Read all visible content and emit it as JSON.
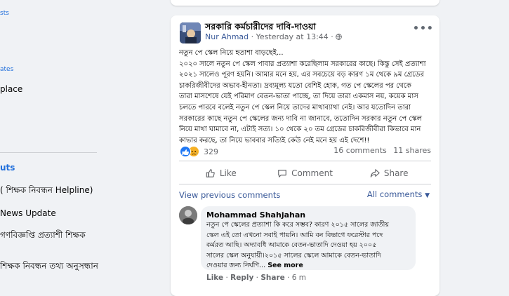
{
  "sidebar": {
    "top_link": "sts",
    "mid_link": "ates",
    "place_fragment": "place",
    "heading": "uts",
    "items": [
      "( শিক্ষক নিবন্ধন Helpline)",
      "News Update",
      "গণবিজ্ঞপ্তি প্রত্যাশী শিক্ষক",
      "শিক্ষক নিবন্ধন তথ্য অনুসন্ধান"
    ]
  },
  "post": {
    "group_name": "সরকারি কর্মচারীদের দাবি-দাওয়া",
    "author": "Nur Ahmad",
    "separator": " · ",
    "time": "Yesterday at 13:44",
    "dot": " · ",
    "more_icon": "more-horizontal-icon",
    "body_lines": [
      "নতুন পে স্কেল নিয়ে হতাশা বাড়ছেই...",
      "২০২০ সালে নতুন পে স্কেল পাবার প্রত্যাশা করেছিলাম সরকারের কাছে। কিন্তু সেই প্রত্যাশা",
      "২০২১ সালেও পূরণ হয়নি। আমার মনে হয়, এর সবচেয়ে বড় কারণ ১ম থেকে ৯ম গ্রেডের",
      "চাকরিজীবীদের অভাব-হীনতা। দ্রব্যমূল্য যতো বেশিই হোক, গত পে স্কেলের পর থেকে",
      "তারা মাসশেষে যেই পরিমাণ বেতন-ভাতা পাচ্ছে, তা দিয়ে তারা একমাস নয়, কয়েক মাস",
      "চলতে পারবে বলেই নতুন পে স্কেল নিয়ে তাদের মাথাব্যাথা নেই। আর যতোদিন তারা",
      "সরকারের কাছে নতুন পে স্কেলের জন্য দাবি না জানাবে, ততোদিন সরকার নতুন পে স্কেল",
      "নিয়ে মাথা ঘামাবে না, এটাই সত্য। ১০ থেকে ২০ তম গ্রেডের চাকরিজীবীরা কিভাবে মান",
      "কাভার করছে, তা নিয়ে ভাববার সত্যিই কেউ নেই মনে হয় এই দেশে!!"
    ],
    "reaction_count": "329",
    "comments_count": "16 comments",
    "shares_count": "11 shares",
    "actions": {
      "like": "Like",
      "comment": "Comment",
      "share": "Share"
    },
    "view_previous": "View previous comments",
    "all_comments": "All comments"
  },
  "comment": {
    "name": "Mohammad Shahjahan",
    "lines": [
      "নতুন পে স্কেলের প্রত্যাশা কি করে সম্ভব? কারণ ২০১৫ সালের জাতীয়",
      "স্কেল এই তো এখনো সবাই পায়নি। আমি বন বিভাগে ফরেস্টার পদে",
      "কর্মরত আছি। অদ্যাবধি আমাকে বেতন-ভাতাদি দেওয়া হয় ২০০৫",
      "সালের স্কেল অনুযায়ী।২০১৫ সালের স্কেলে আমাকে বেতন-ভাতাদি"
    ],
    "last_line": "দেওয়ার জন্য নির্ঘণি... ",
    "see_more": "See more",
    "like": "Like",
    "reply": "Reply",
    "share": "Share",
    "time": "6 m",
    "sep": " · "
  },
  "colors": {
    "link": "#385898",
    "like_blue": "#2078f4",
    "sad_yellow": "#f7b125",
    "background": "#f0f2f5"
  }
}
